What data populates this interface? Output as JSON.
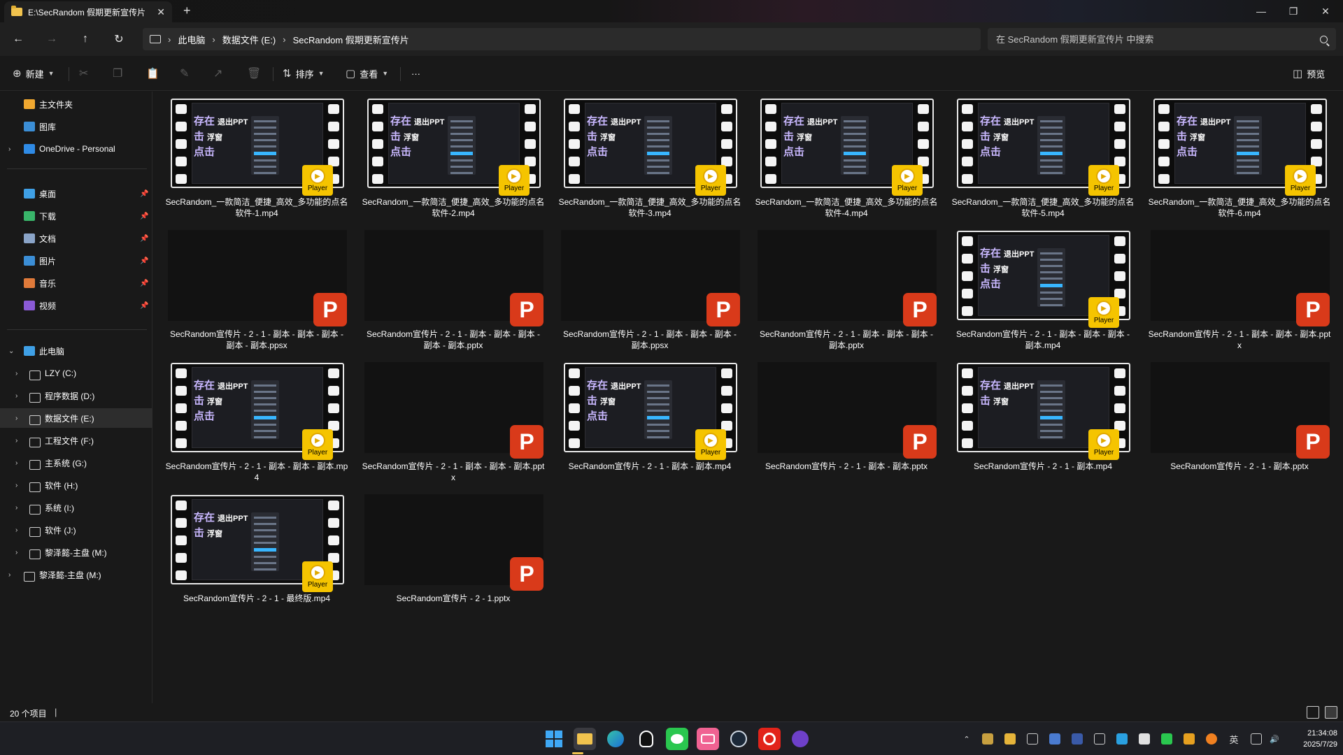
{
  "window": {
    "tab_title": "E:\\SecRandom 假期更新宣传片",
    "tab_close": "✕",
    "new_tab": "+",
    "controls": [
      "—",
      "❐",
      "✕"
    ]
  },
  "address": {
    "breadcrumb": [
      "此电脑",
      "数据文件 (E:)",
      "SecRandom 假期更新宣传片"
    ],
    "search_placeholder": "在 SecRandom 假期更新宣传片 中搜索"
  },
  "toolbar": {
    "new_label": "新建",
    "sort_label": "排序",
    "view_label": "查看",
    "more_label": "···",
    "preview_label": "预览"
  },
  "sidebar": {
    "quick": [
      {
        "label": "主文件夹",
        "icon": "home-icon"
      },
      {
        "label": "图库",
        "icon": "gallery-icon"
      },
      {
        "label": "OneDrive - Personal",
        "icon": "onedrive-icon"
      }
    ],
    "pinned": [
      {
        "label": "桌面",
        "icon": "desktop-icon"
      },
      {
        "label": "下载",
        "icon": "download-icon"
      },
      {
        "label": "文档",
        "icon": "documents-icon"
      },
      {
        "label": "图片",
        "icon": "pictures-icon"
      },
      {
        "label": "音乐",
        "icon": "music-icon"
      },
      {
        "label": "视频",
        "icon": "videos-icon"
      }
    ],
    "this_pc": "此电脑",
    "drives": [
      "LZY (C:)",
      "程序数据 (D:)",
      "数据文件 (E:)",
      "工程文件 (F:)",
      "主系统 (G:)",
      "软件 (H:)",
      "系统 (I:)",
      "软件 (J:)",
      "黎泽懿-主盘 (M:)"
    ],
    "network": "黎泽懿-主盘 (M:)"
  },
  "files": [
    {
      "name": "SecRandom_一款简洁_便捷_高效_多功能的点名软件-1.mp4",
      "type": "mp4"
    },
    {
      "name": "SecRandom_一款简洁_便捷_高效_多功能的点名软件-2.mp4",
      "type": "mp4"
    },
    {
      "name": "SecRandom_一款简洁_便捷_高效_多功能的点名软件-3.mp4",
      "type": "mp4"
    },
    {
      "name": "SecRandom_一款简洁_便捷_高效_多功能的点名软件-4.mp4",
      "type": "mp4"
    },
    {
      "name": "SecRandom_一款简洁_便捷_高效_多功能的点名软件-5.mp4",
      "type": "mp4"
    },
    {
      "name": "SecRandom_一款简洁_便捷_高效_多功能的点名软件-6.mp4",
      "type": "mp4"
    },
    {
      "name": "SecRandom宣传片 - 2 - 1 - 副本 - 副本 - 副本 - 副本 - 副本.ppsx",
      "type": "ppt"
    },
    {
      "name": "SecRandom宣传片 - 2 - 1 - 副本 - 副本 - 副本 - 副本 - 副本.pptx",
      "type": "ppt"
    },
    {
      "name": "SecRandom宣传片 - 2 - 1 - 副本 - 副本 - 副本 - 副本.ppsx",
      "type": "ppt"
    },
    {
      "name": "SecRandom宣传片 - 2 - 1 - 副本 - 副本 - 副本 - 副本.pptx",
      "type": "ppt"
    },
    {
      "name": "SecRandom宣传片 - 2 - 1 - 副本 - 副本 - 副本 - 副本.mp4",
      "type": "mp4"
    },
    {
      "name": "SecRandom宣传片 - 2 - 1 - 副本 - 副本 - 副本.pptx",
      "type": "ppt"
    },
    {
      "name": "SecRandom宣传片 - 2 - 1 - 副本 - 副本 - 副本.mp4",
      "type": "mp4"
    },
    {
      "name": "SecRandom宣传片 - 2 - 1 - 副本 - 副本 - 副本.pptx",
      "type": "ppt"
    },
    {
      "name": "SecRandom宣传片 - 2 - 1 - 副本 - 副本.mp4",
      "type": "mp4"
    },
    {
      "name": "SecRandom宣传片 - 2 - 1 - 副本 - 副本.pptx",
      "type": "ppt"
    },
    {
      "name": "SecRandom宣传片 - 2 - 1 - 副本.mp4",
      "type": "mp4"
    },
    {
      "name": "SecRandom宣传片 - 2 - 1 - 副本.pptx",
      "type": "ppt"
    },
    {
      "name": "SecRandom宣传片 - 2 - 1 - 最终版.mp4",
      "type": "mp4"
    },
    {
      "name": "SecRandom宣传片 - 2 - 1.pptx",
      "type": "ppt"
    }
  ],
  "thumb_text": {
    "line1": "存在",
    "line1b": "退出PPT",
    "line2": "击",
    "line2b": "浮窗",
    "line3": "点击",
    "player": "Player",
    "ppt": "P"
  },
  "status": {
    "count": "20 个项目"
  },
  "taskbar": {
    "apps": [
      "start-icon",
      "file-explorer-icon",
      "edge-icon",
      "qq-icon",
      "wechat-icon",
      "bilibili-icon",
      "steam-icon",
      "netease-music-icon",
      "github-icon"
    ],
    "ime": "英",
    "time": "21:34:08",
    "date": "2025/7/29"
  },
  "colors": {
    "accent": "#f5c400",
    "ppt": "#d93a1a",
    "background": "#191919"
  }
}
